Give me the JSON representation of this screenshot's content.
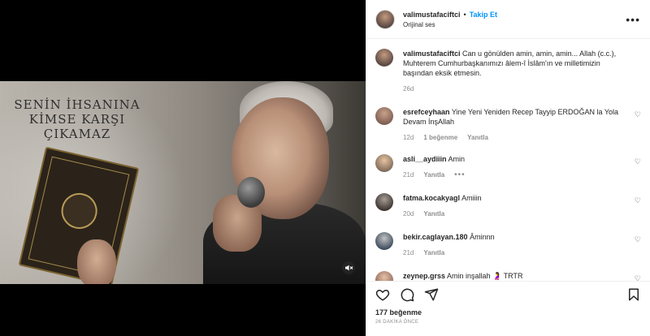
{
  "media": {
    "quote_lines": [
      "SENİN İHSANINA",
      "KİMSE KARŞI",
      "ÇIKAMAZ"
    ],
    "mute_icon": "speaker-muted-icon"
  },
  "header": {
    "username": "valimustafaciftci",
    "separator": "•",
    "follow_label": "Takip Et",
    "audio_label": "Orijinal ses",
    "more_label": "•••"
  },
  "caption": {
    "username": "valimustafaciftci",
    "text": "Can u gönülden amin, amin, amin... Allah (c.c.), Muhterem Cumhurbaşkanımızı âlem-î İslâm'ın ve milletimizin başından eksik etmesin.",
    "time": "26d"
  },
  "comments": [
    {
      "username": "esrefceyhaan",
      "text": "Yine Yeni Yeniden Recep Tayyip ERDOĞAN la Yola Devam İnşAllah",
      "time": "12d",
      "likes": "1 beğenme",
      "reply": "Yanıtla"
    },
    {
      "username": "asli__aydiiin",
      "text": "Amin",
      "time": "21d",
      "reply": "Yanıtla",
      "more": "•••"
    },
    {
      "username": "fatma.kocakyagl",
      "text": "Amiiin",
      "time": "20d",
      "reply": "Yanıtla"
    },
    {
      "username": "bekir.caglayan.180",
      "text": "Âminnn",
      "time": "21d",
      "reply": "Yanıtla"
    },
    {
      "username": "zeynep.grss",
      "text": "Amin inşallah 🤰 TRTR",
      "time": "",
      "reply": ""
    }
  ],
  "actions": {
    "likes": "177 beğenme",
    "timestamp": "26 DAKİKA ÖNCE"
  },
  "colors": {
    "accent": "#0095f6",
    "text": "#262626",
    "muted": "#8e8e8e",
    "border": "#efefef"
  }
}
